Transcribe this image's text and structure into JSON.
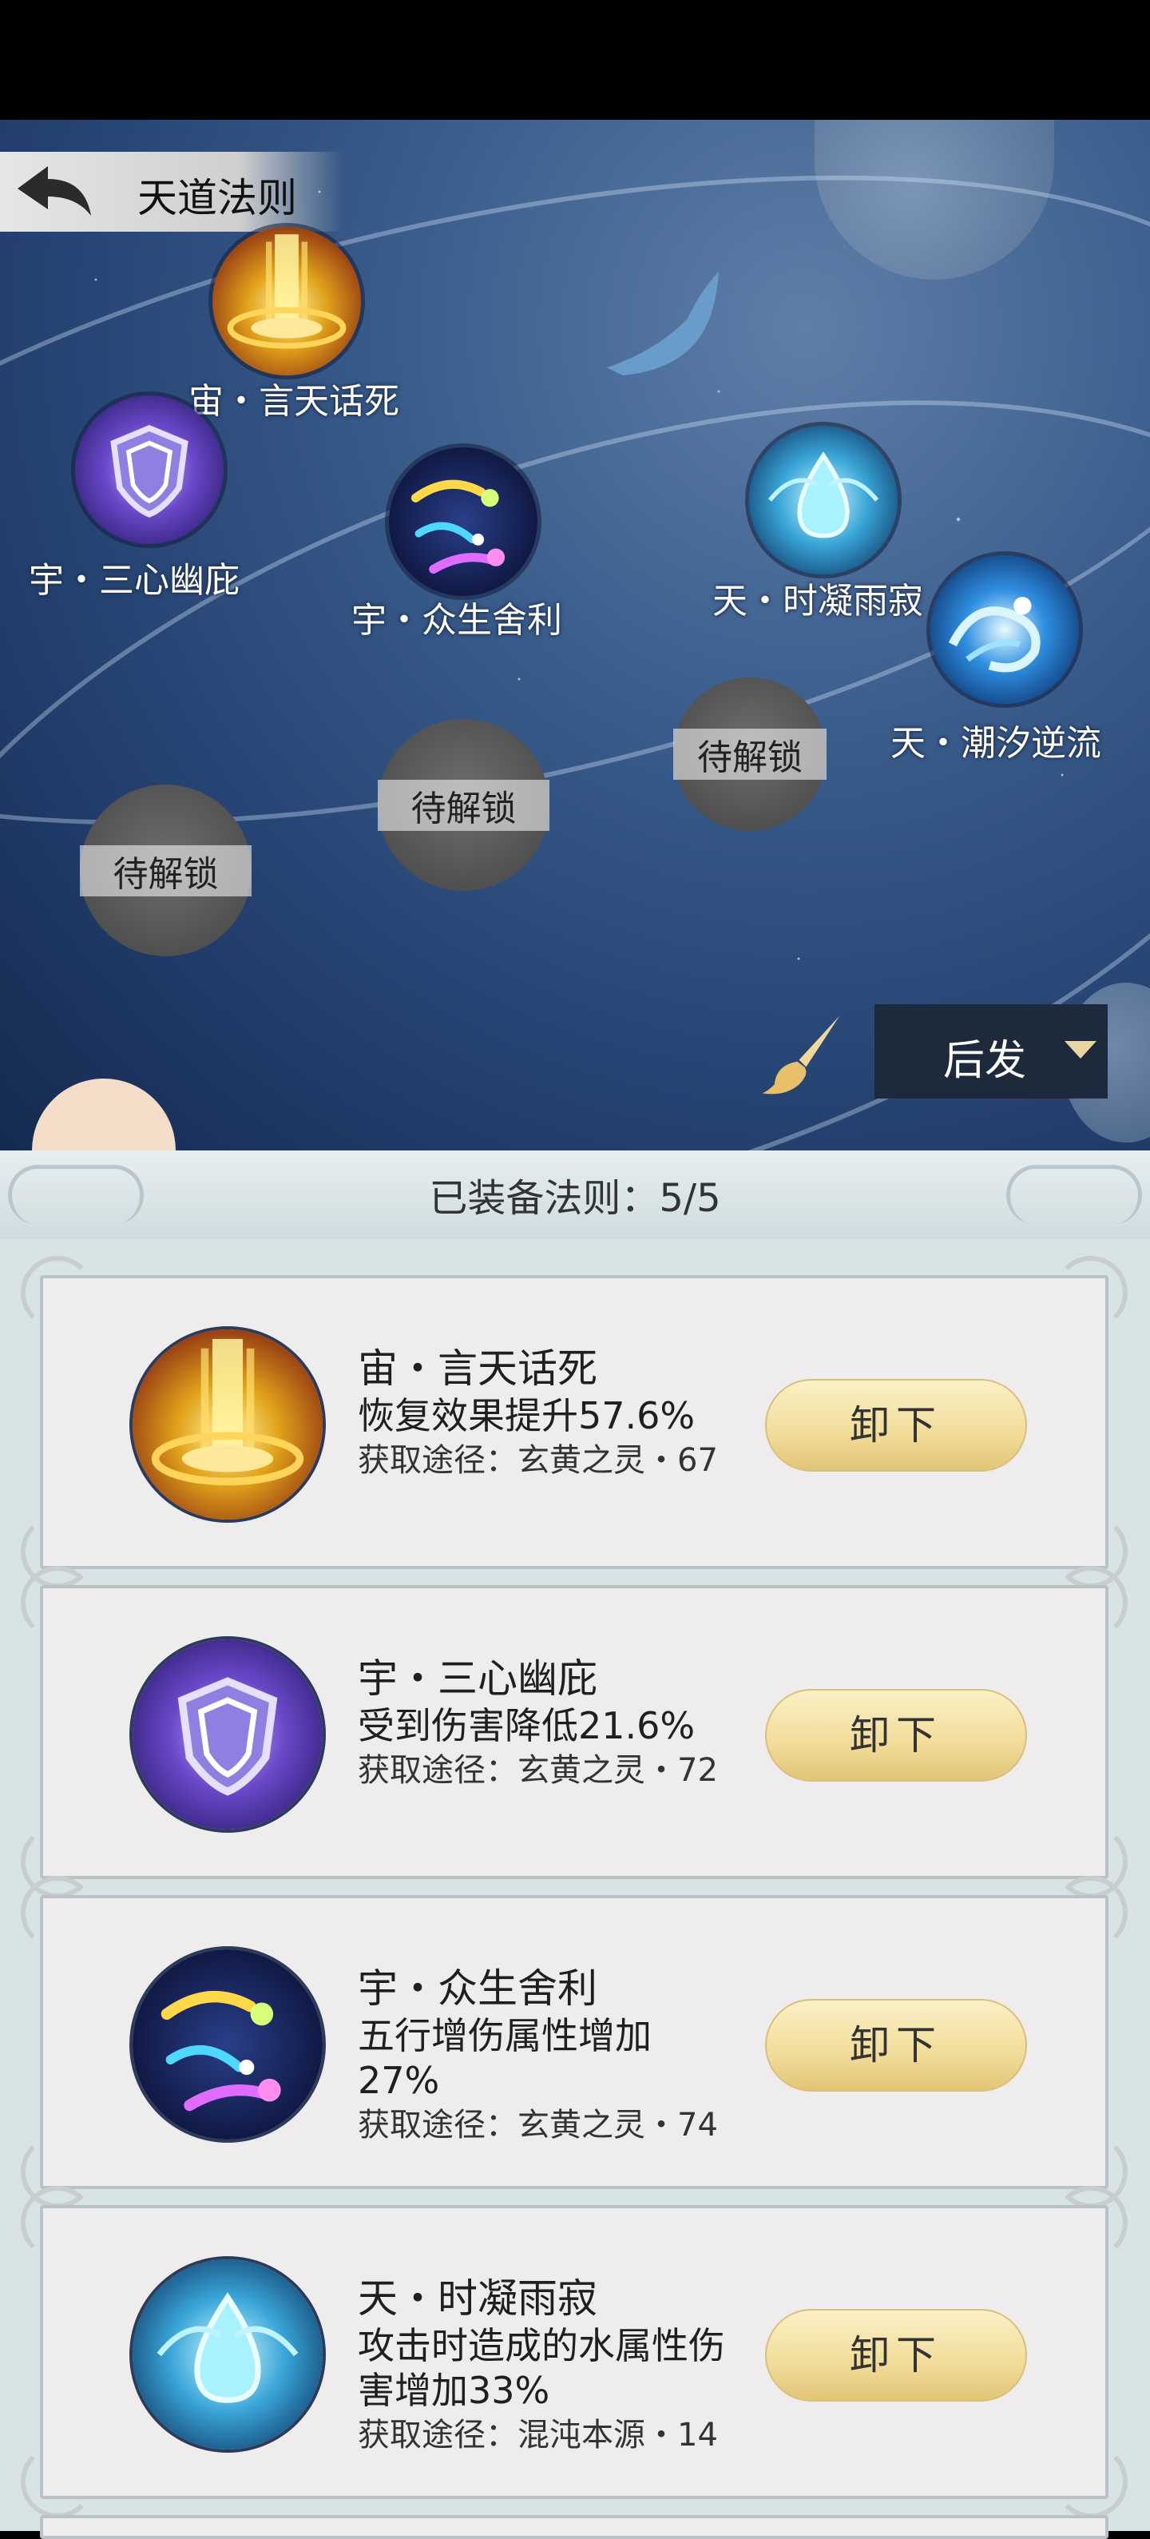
{
  "header": {
    "title": "天道法则"
  },
  "scene": {
    "nodes": [
      {
        "label": "宙・言天话死",
        "icon": "golden-light-pillar"
      },
      {
        "label": "宇・三心幽庇",
        "icon": "purple-shield"
      },
      {
        "label": "宇・众生舍利",
        "icon": "cosmic-comets"
      },
      {
        "label": "天・时凝雨寂",
        "icon": "water-drop"
      },
      {
        "label": "天・潮汐逆流",
        "icon": "tidal-wave"
      }
    ],
    "locked_label": "待解锁",
    "locked_count": 3
  },
  "toolbar": {
    "brush_icon": "brush-icon",
    "dropdown_value": "后发"
  },
  "panel": {
    "equip_count": "已装备法则：5/5",
    "unequip_label": "卸下",
    "cards": [
      {
        "name": "宙・言天话死",
        "effect": "恢复效果提升57.6%",
        "source": "获取途径：玄黄之灵・67",
        "icon": "golden-light-pillar"
      },
      {
        "name": "宇・三心幽庇",
        "effect": "受到伤害降低21.6%",
        "source": "获取途径：玄黄之灵・72",
        "icon": "purple-shield"
      },
      {
        "name": "宇・众生舍利",
        "effect": "五行增伤属性增加27%",
        "source": "获取途径：玄黄之灵・74",
        "icon": "cosmic-comets"
      },
      {
        "name": "天・时凝雨寂",
        "effect": "攻击时造成的水属性伤害增加33%",
        "source": "获取途径：混沌本源・14",
        "icon": "water-drop"
      }
    ]
  },
  "colors": {
    "dropdown_bg": "#1c2a3b",
    "button_gold": "#f1dc99",
    "panel_bg": "#d8e3e5"
  }
}
